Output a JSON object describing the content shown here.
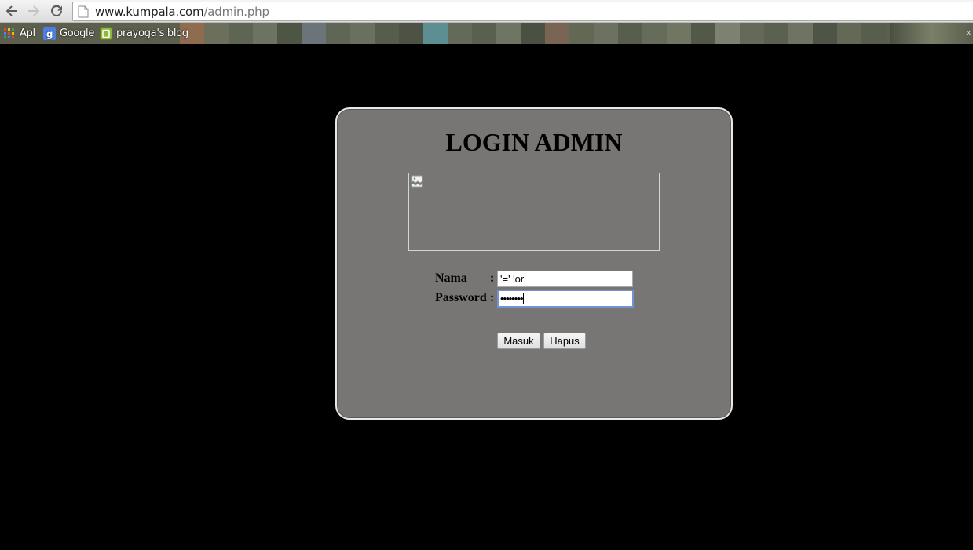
{
  "browser": {
    "url_host": "www.kumpala.com",
    "url_path": "/admin.php",
    "bookmarks": [
      {
        "label": "Apl",
        "icon": "apps-grid-icon"
      },
      {
        "label": "Google",
        "icon": "google-icon"
      },
      {
        "label": "prayoga's blog",
        "icon": "blog-icon"
      }
    ]
  },
  "login": {
    "title": "LOGIN ADMIN",
    "banner_icon": "broken-image-icon",
    "name_label": "Nama",
    "password_label": "Password",
    "colon": ":",
    "name_value": "'=' 'or'",
    "password_value": "••••••••",
    "submit_label": "Masuk",
    "reset_label": "Hapus"
  },
  "colors": {
    "page_background": "#000000",
    "panel_background": "#777675",
    "panel_border": "#e8e8e8",
    "focus_ring": "#6f93d5"
  }
}
